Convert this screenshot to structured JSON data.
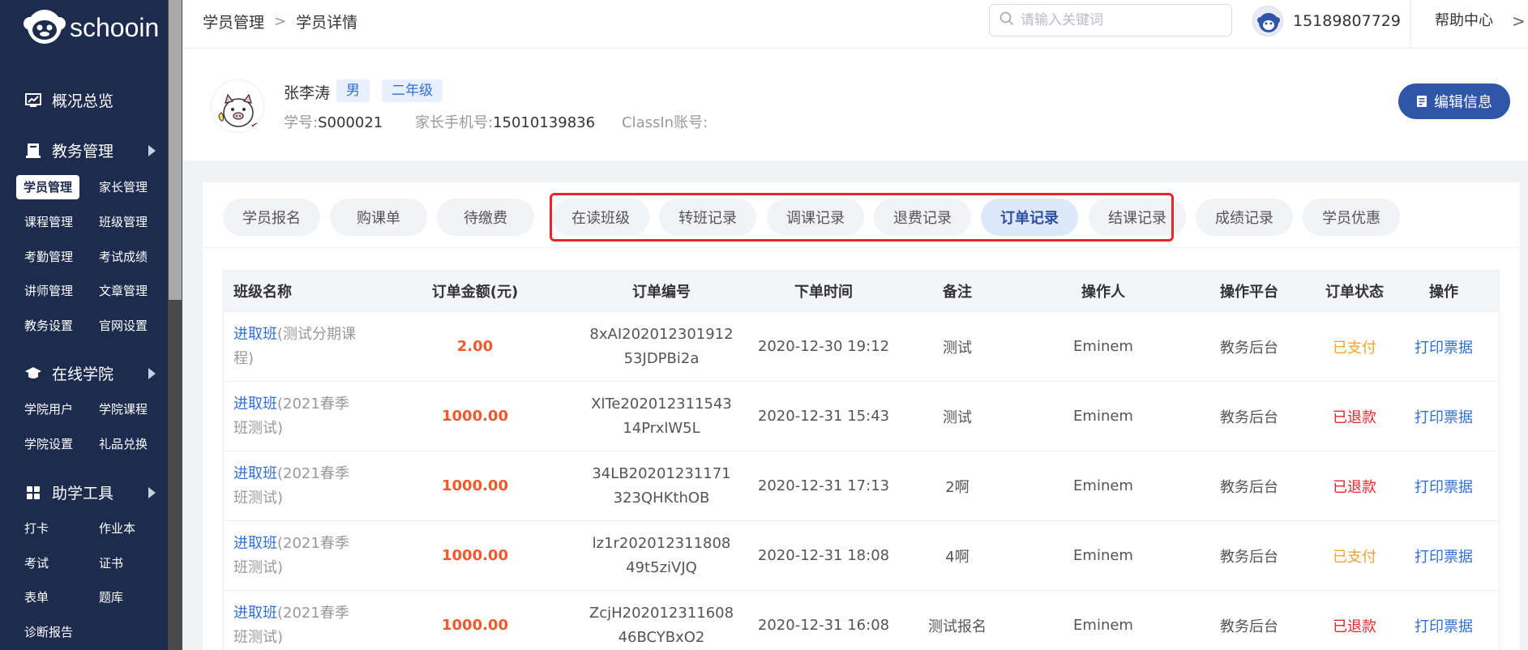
{
  "app": {
    "logo_text": "schooin"
  },
  "sidebar": {
    "sections": [
      {
        "label": "概况总览"
      },
      {
        "label": "教务管理"
      },
      {
        "label": "在线学院"
      },
      {
        "label": "助学工具"
      }
    ],
    "items": [
      {
        "label": "学员管理"
      },
      {
        "label": "家长管理"
      },
      {
        "label": "课程管理"
      },
      {
        "label": "班级管理"
      },
      {
        "label": "考勤管理"
      },
      {
        "label": "考试成绩"
      },
      {
        "label": "讲师管理"
      },
      {
        "label": "文章管理"
      },
      {
        "label": "教务设置"
      },
      {
        "label": "官网设置"
      },
      {
        "label": "学院用户"
      },
      {
        "label": "学院课程"
      },
      {
        "label": "学院设置"
      },
      {
        "label": "礼品兑换"
      },
      {
        "label": "打卡"
      },
      {
        "label": "作业本"
      },
      {
        "label": "考试"
      },
      {
        "label": "证书"
      },
      {
        "label": "表单"
      },
      {
        "label": "题库"
      },
      {
        "label": "诊断报告"
      }
    ]
  },
  "header": {
    "breadcrumb": [
      "学员管理",
      "学员详情"
    ],
    "breadcrumb_sep": ">",
    "search_placeholder": "请输入关键词",
    "phone": "15189807729",
    "help": "帮助中心",
    "help_chevron": ">"
  },
  "student": {
    "name": "张李涛",
    "gender": "男",
    "grade": "二年级",
    "id_label": "学号:",
    "id_value": "S000021",
    "parent_phone_label": "家长手机号:",
    "parent_phone_value": "15010139836",
    "classin_label": "ClassIn账号:",
    "classin_value": "",
    "edit_button": "编辑信息"
  },
  "tabs": [
    {
      "label": "学员报名"
    },
    {
      "label": "购课单"
    },
    {
      "label": "待缴费"
    },
    {
      "label": "在读班级"
    },
    {
      "label": "转班记录"
    },
    {
      "label": "调课记录"
    },
    {
      "label": "退费记录"
    },
    {
      "label": "订单记录",
      "active": true
    },
    {
      "label": "结课记录"
    },
    {
      "label": "成绩记录"
    },
    {
      "label": "学员优惠"
    }
  ],
  "table": {
    "columns": [
      "班级名称",
      "订单金额(元)",
      "订单编号",
      "下单时间",
      "备注",
      "操作人",
      "操作平台",
      "订单状态",
      "操作"
    ],
    "rows": [
      {
        "class_link": "进取班",
        "class_sub": "(测试分期课程)",
        "amount": "2.00",
        "order_no_1": "8xAI202012301912",
        "order_no_2": "53JDPBi2a",
        "time": "2020-12-30 19:12",
        "remark": "测试",
        "operator": "Eminem",
        "platform": "教务后台",
        "status": "已支付",
        "status_type": "paid",
        "action": "打印票据"
      },
      {
        "class_link": "进取班",
        "class_sub": "(2021春季班测试)",
        "amount": "1000.00",
        "order_no_1": "XlTe202012311543",
        "order_no_2": "14PrxlW5L",
        "time": "2020-12-31 15:43",
        "remark": "测试",
        "operator": "Eminem",
        "platform": "教务后台",
        "status": "已退款",
        "status_type": "refund",
        "action": "打印票据"
      },
      {
        "class_link": "进取班",
        "class_sub": "(2021春季班测试)",
        "amount": "1000.00",
        "order_no_1": "34LB20201231171",
        "order_no_2": "323QHKthOB",
        "time": "2020-12-31 17:13",
        "remark": "2啊",
        "operator": "Eminem",
        "platform": "教务后台",
        "status": "已退款",
        "status_type": "refund",
        "action": "打印票据"
      },
      {
        "class_link": "进取班",
        "class_sub": "(2021春季班测试)",
        "amount": "1000.00",
        "order_no_1": "lz1r202012311808",
        "order_no_2": "49t5ziVJQ",
        "time": "2020-12-31 18:08",
        "remark": "4啊",
        "operator": "Eminem",
        "platform": "教务后台",
        "status": "已支付",
        "status_type": "paid",
        "action": "打印票据"
      },
      {
        "class_link": "进取班",
        "class_sub": "(2021春季班测试)",
        "amount": "1000.00",
        "order_no_1": "ZcjH202012311608",
        "order_no_2": "46BCYBxO2",
        "time": "2020-12-31 16:08",
        "remark": "测试报名",
        "operator": "Eminem",
        "platform": "教务后台",
        "status": "已退款",
        "status_type": "refund",
        "action": "打印票据"
      }
    ]
  },
  "colors": {
    "sidebar_bg": "#1d2b4f",
    "accent": "#2f56a8",
    "link": "#2f6fd6",
    "amount": "#f0592b",
    "paid": "#f0a531",
    "refund": "#e8262b",
    "highlight_border": "#e8262b"
  }
}
